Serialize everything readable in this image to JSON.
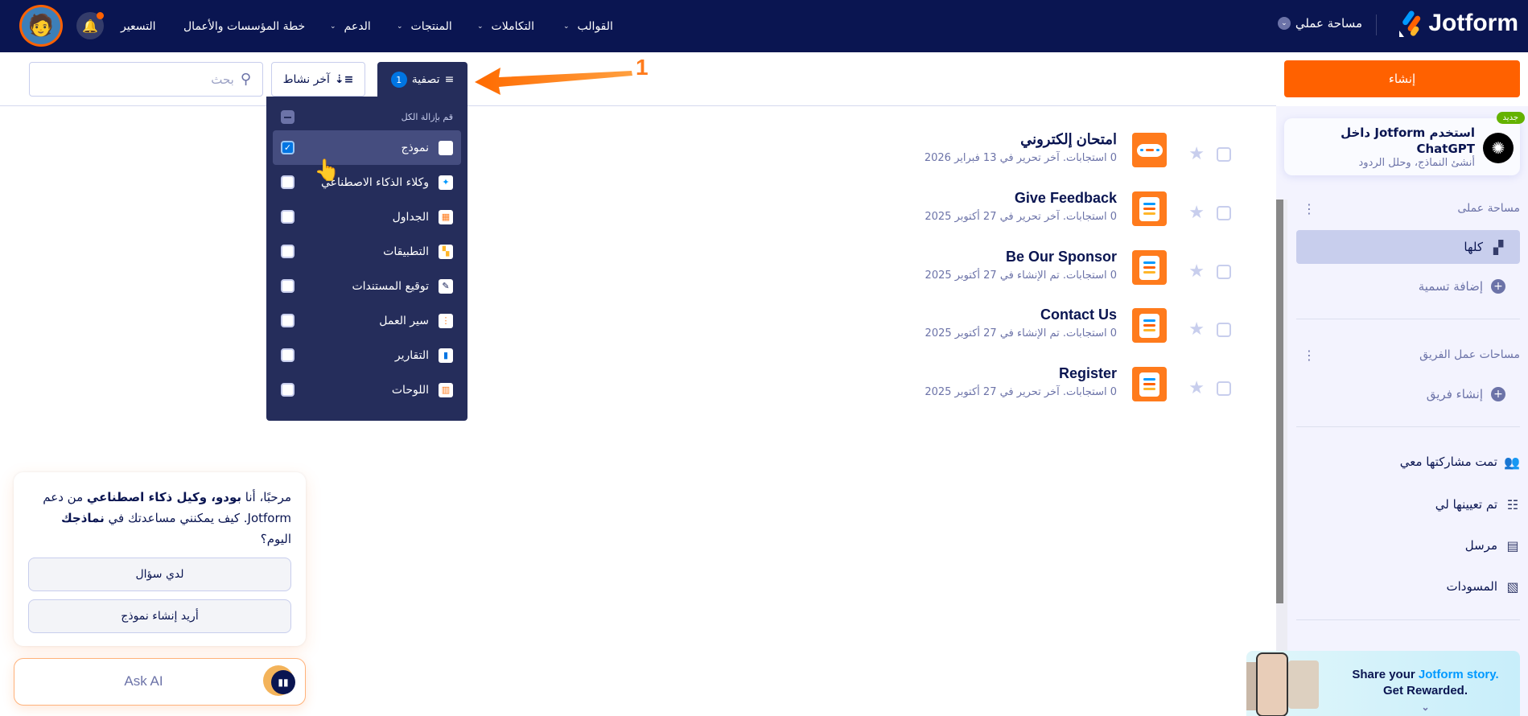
{
  "header": {
    "brand": "Jotform",
    "workspace": "مساحة عملي",
    "nav": [
      "القوالب",
      "التكاملات",
      "المنتجات",
      "الدعم",
      "خطة المؤسسات والأعمال",
      "التسعير"
    ],
    "nav_dropdown": [
      true,
      true,
      true,
      true,
      false,
      false
    ]
  },
  "toolbar": {
    "create": "إنشاء",
    "filter_label": "تصفية",
    "filter_count": "1",
    "sort_label": "آخر نشاط",
    "search_placeholder": "بحث"
  },
  "filter_menu": {
    "clear_all": "قم بإزالة الكل",
    "items": [
      {
        "label": "نموذج",
        "checked": true
      },
      {
        "label": "وكلاء الذكاء الاصطناعي",
        "checked": false
      },
      {
        "label": "الجداول",
        "checked": false
      },
      {
        "label": "التطبيقات",
        "checked": false
      },
      {
        "label": "توقيع المستندات",
        "checked": false
      },
      {
        "label": "سير العمل",
        "checked": false
      },
      {
        "label": "التقارير",
        "checked": false
      },
      {
        "label": "اللوحات",
        "checked": false
      }
    ]
  },
  "annotation": {
    "number": "1"
  },
  "forms": [
    {
      "title": "امتحان إلكتروني",
      "meta": "0 استجابات. آخر تحرير في 13 فبراير 2026"
    },
    {
      "title": "Give Feedback",
      "meta": "0 استجابات. آخر تحرير في 27 أكتوبر 2025"
    },
    {
      "title": "Be Our Sponsor",
      "meta": "0 استجابات. تم الإنشاء في 27 أكتوبر 2025"
    },
    {
      "title": "Contact Us",
      "meta": "0 استجابات. تم الإنشاء في 27 أكتوبر 2025"
    },
    {
      "title": "Register",
      "meta": "0 استجابات. آخر تحرير في 27 أكتوبر 2025"
    }
  ],
  "sidebar": {
    "gpt_card": {
      "title": "استخدم Jotform داخل ChatGPT",
      "subtitle": "أنشئ النماذج، وحلل الردود",
      "badge": "جديد"
    },
    "my_workspace": "مساحة عملى",
    "all": "كلها",
    "add_label": "إضافة تسمية",
    "team_workspaces": "مساحات عمل الفريق",
    "create_team": "إنشاء فريق",
    "shared": "تمت مشاركتها معي",
    "assigned": "تم تعيينها لي",
    "sent": "مرسل",
    "drafts": "المسودات"
  },
  "promo": {
    "line1a": "Share your",
    "line1b": "Jotform story.",
    "line2": "Get Rewarded."
  },
  "chat": {
    "message_1": "مرحبًا، أنا ",
    "message_bold_1": "بودو، وكيل ذكاء اصطناعي",
    "message_2": " من دعم Jotform. كيف يمكنني مساعدتك في ",
    "message_bold_2": "نماذجك",
    "message_3": " اليوم؟",
    "btn_question": "لدي سؤال",
    "btn_create": "أريد إنشاء نموذج",
    "ask_ai": "Ask AI"
  },
  "colors": {
    "navy": "#0a1551",
    "orange": "#ff6100",
    "blue": "#0075e3",
    "menu": "#252d5b"
  }
}
